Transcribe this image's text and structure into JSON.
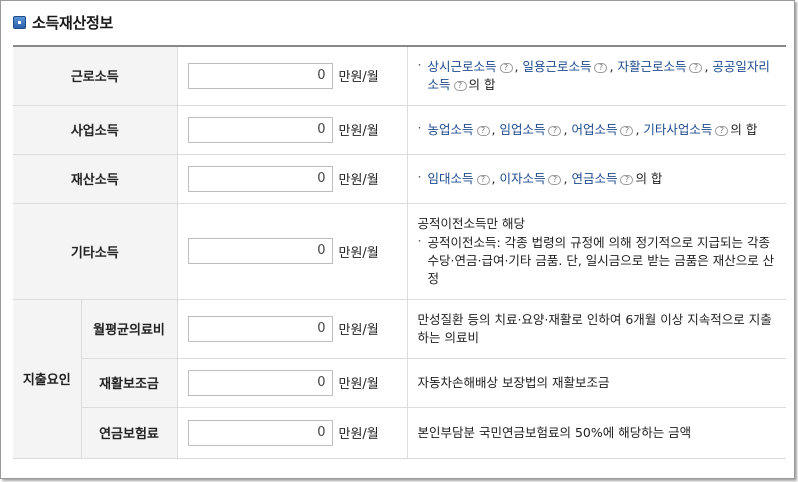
{
  "section": {
    "title": "소득재산정보",
    "icon": "square-bullet-icon"
  },
  "unit": "만원/월",
  "rows": {
    "earned": {
      "label": "근로소득",
      "value": "0",
      "items": [
        "상시근로소득",
        "일용근로소득",
        "자활근로소득",
        "공공일자리소득"
      ],
      "suffix": "의 합"
    },
    "business": {
      "label": "사업소득",
      "value": "0",
      "items": [
        "농업소득",
        "임업소득",
        "어업소득",
        "기타사업소득"
      ],
      "suffix": "의 합"
    },
    "property": {
      "label": "재산소득",
      "value": "0",
      "items": [
        "임대소득",
        "이자소득",
        "연금소득"
      ],
      "suffix": "의 합"
    },
    "other": {
      "label": "기타소득",
      "value": "0",
      "note_head": "공적이전소득만 해당",
      "note": "공적이전소득: 각종 법령의 규정에 의해 정기적으로 지급되는 각종 수당·연금·급여·기타 금품. 단, 일시금으로 받는 금품은 재산으로 산정"
    }
  },
  "expense": {
    "group_label": "지출요인",
    "rows": {
      "medical": {
        "label": "월평균의료비",
        "value": "0",
        "desc": "만성질환 등의 치료·요양·재활로 인하여 6개월 이상 지속적으로 지출하는 의료비"
      },
      "rehab": {
        "label": "재활보조금",
        "value": "0",
        "desc": "자동차손해배상 보장법의 재활보조금"
      },
      "pension": {
        "label": "연금보험료",
        "value": "0",
        "desc": "본인부담분 국민연금보험료의 50%에 해당하는 금액"
      }
    }
  }
}
